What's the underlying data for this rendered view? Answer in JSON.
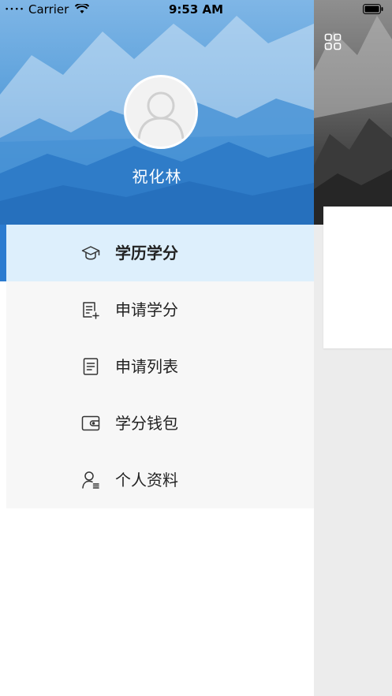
{
  "status_bar": {
    "carrier": "Carrier",
    "time": "9:53 AM"
  },
  "drawer": {
    "username": "祝化林",
    "menu": [
      {
        "label": "学历学分",
        "icon": "graduation-cap-icon",
        "active": true
      },
      {
        "label": "申请学分",
        "icon": "document-add-icon",
        "active": false
      },
      {
        "label": "申请列表",
        "icon": "document-list-icon",
        "active": false
      },
      {
        "label": "学分钱包",
        "icon": "wallet-icon",
        "active": false
      },
      {
        "label": "个人资料",
        "icon": "user-profile-icon",
        "active": false
      }
    ]
  },
  "colors": {
    "header_blue": "#3b86cf",
    "active_bg": "#ddeffc",
    "active_bar": "#2b7bd0",
    "menu_bg": "#f7f7f7"
  }
}
